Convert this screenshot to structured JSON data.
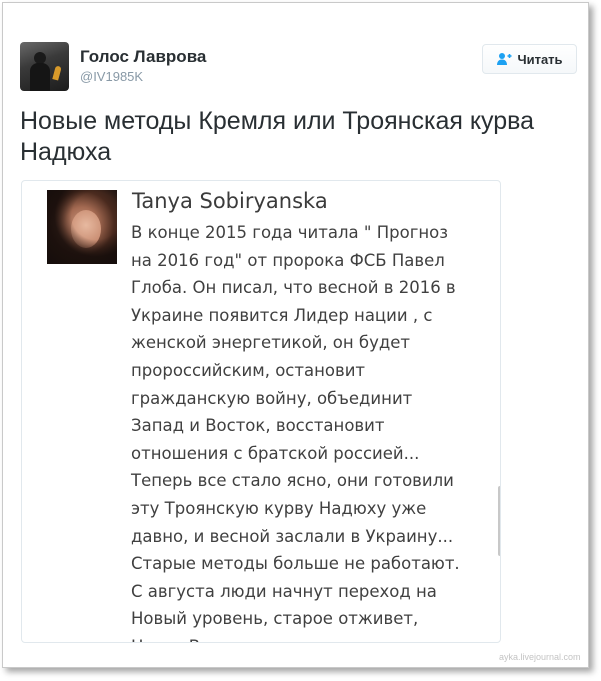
{
  "tweet": {
    "display_name": "Голос Лаврова",
    "handle": "@IV1985K",
    "follow_label": "Читать",
    "text": "Новые методы Кремля или Троянская курва Надюха"
  },
  "embedded_post": {
    "author": "Tanya Sobiryanska",
    "lines": [
      "В конце 2015 года читала \" Прогноз",
      "на 2016 год\" от пророка ФСБ Павел",
      "Глоба. Он писал, что весной в 2016 в",
      "Украине появится Лидер нации , с",
      "женской энергетикой, он будет",
      "пророссийским, остановит",
      "гражданскую войну, объединит",
      "Запад и Восток, восстановит",
      "отношения с братской россией...",
      " Теперь все стало ясно, они готовили",
      "эту Троянскую курву Надюху уже",
      "давно, и весной заслали в Украину...",
      "Старые методы больше не работают.",
      "С августа люди начнут переход на",
      "Новый уровень, старое отживет,",
      "Новое Возродится"
    ]
  },
  "watermark": "ayka.livejournal.com",
  "icons": {
    "follow": "add-user-icon",
    "profile": "avatar"
  },
  "colors": {
    "accent": "#1da1f2",
    "text": "#292f33",
    "muted": "#8899a6"
  }
}
